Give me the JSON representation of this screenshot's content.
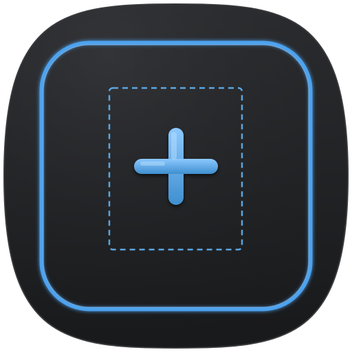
{
  "icon": {
    "name": "add-frame-app-icon",
    "glyph": "plus-icon",
    "colors": {
      "base_dark": "#202123",
      "base_edge": "#3a3b3e",
      "accent": "#4da3ef",
      "accent_light": "#8cc9ff",
      "accent_dim": "#3f8fcf",
      "dashed": "#5aa6e0"
    }
  }
}
